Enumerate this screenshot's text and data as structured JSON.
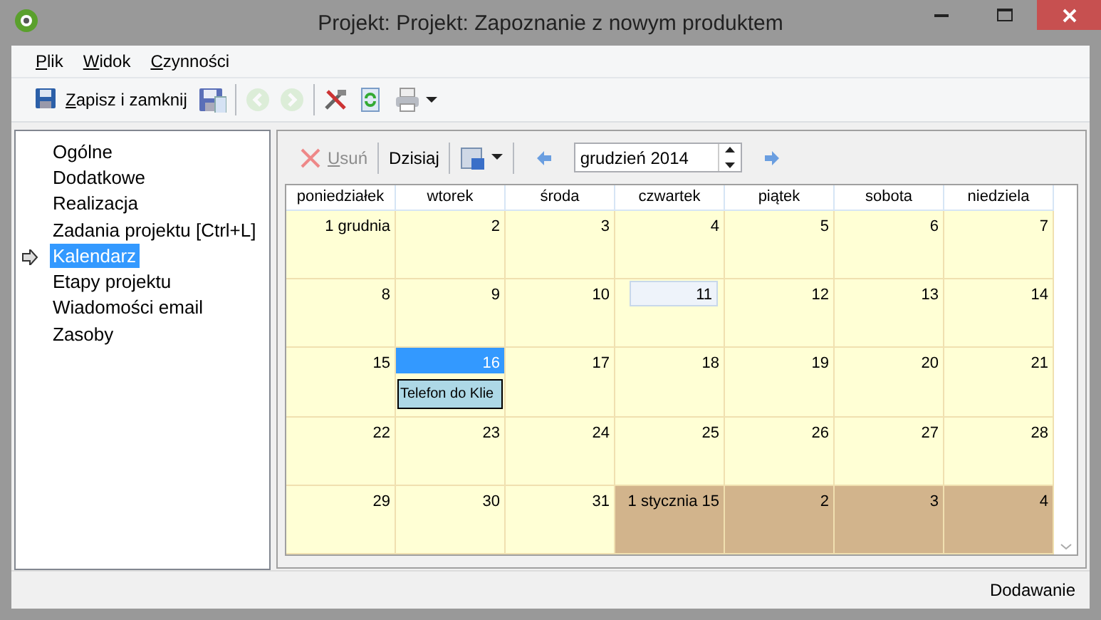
{
  "window": {
    "title": "Projekt: Projekt: Zapoznanie z nowym produktem"
  },
  "menu": [
    {
      "label": "Plik"
    },
    {
      "label": "Widok"
    },
    {
      "label": "Czynności"
    }
  ],
  "toolbar": [
    {
      "kind": "button",
      "label": "Zapisz i zamknij",
      "disabled": false
    },
    {
      "kind": "icon",
      "disabled": false
    },
    {
      "kind": "separator"
    },
    {
      "kind": "icon",
      "disabled": true
    },
    {
      "kind": "icon",
      "disabled": true
    },
    {
      "kind": "separator"
    },
    {
      "kind": "icon",
      "disabled": false
    },
    {
      "kind": "icon",
      "disabled": false
    },
    {
      "kind": "dropdown",
      "disabled": false
    }
  ],
  "sidebar": {
    "items": [
      {
        "label": "Ogólne",
        "selected": false
      },
      {
        "label": "Dodatkowe",
        "selected": false
      },
      {
        "label": "Realizacja",
        "selected": false
      },
      {
        "label": "Zadania projektu [Ctrl+L]",
        "selected": false
      },
      {
        "label": "Kalendarz",
        "selected": true
      },
      {
        "label": "Etapy projektu",
        "selected": false
      },
      {
        "label": "Wiadomości email",
        "selected": false
      },
      {
        "label": "Zasoby",
        "selected": false
      }
    ]
  },
  "calendar_toolbar": {
    "delete": {
      "label": "Usuń",
      "disabled": true
    },
    "today": {
      "label": "Dzisiaj"
    },
    "month": {
      "value": "grudzień 2014"
    }
  },
  "calendar": {
    "columns": [
      "poniedziałek",
      "wtorek",
      "środa",
      "czwartek",
      "piątek",
      "sobota",
      "niedziela"
    ],
    "weeks": [
      [
        {
          "day": "1 grudnia",
          "kind": "current"
        },
        {
          "day": "2",
          "kind": "current"
        },
        {
          "day": "3",
          "kind": "current"
        },
        {
          "day": "4",
          "kind": "current"
        },
        {
          "day": "5",
          "kind": "current"
        },
        {
          "day": "6",
          "kind": "current"
        },
        {
          "day": "7",
          "kind": "current"
        }
      ],
      [
        {
          "day": "8",
          "kind": "current"
        },
        {
          "day": "9",
          "kind": "current"
        },
        {
          "day": "10",
          "kind": "current"
        },
        {
          "day": "11",
          "kind": "today"
        },
        {
          "day": "12",
          "kind": "current"
        },
        {
          "day": "13",
          "kind": "current"
        },
        {
          "day": "14",
          "kind": "current"
        }
      ],
      [
        {
          "day": "15",
          "kind": "current"
        },
        {
          "day": "16",
          "kind": "current",
          "selected": true,
          "events": [
            "Telefon do Klie"
          ]
        },
        {
          "day": "17",
          "kind": "current"
        },
        {
          "day": "18",
          "kind": "current"
        },
        {
          "day": "19",
          "kind": "current"
        },
        {
          "day": "20",
          "kind": "current"
        },
        {
          "day": "21",
          "kind": "current"
        }
      ],
      [
        {
          "day": "22",
          "kind": "current"
        },
        {
          "day": "23",
          "kind": "current"
        },
        {
          "day": "24",
          "kind": "current"
        },
        {
          "day": "25",
          "kind": "current"
        },
        {
          "day": "26",
          "kind": "current"
        },
        {
          "day": "27",
          "kind": "current"
        },
        {
          "day": "28",
          "kind": "current"
        }
      ],
      [
        {
          "day": "29",
          "kind": "current"
        },
        {
          "day": "30",
          "kind": "current"
        },
        {
          "day": "31",
          "kind": "current"
        },
        {
          "day": "1 stycznia 15",
          "kind": "other"
        },
        {
          "day": "2",
          "kind": "other"
        },
        {
          "day": "3",
          "kind": "other"
        },
        {
          "day": "4",
          "kind": "other"
        }
      ]
    ]
  },
  "status_bar": {
    "text": "Dodawanie"
  }
}
